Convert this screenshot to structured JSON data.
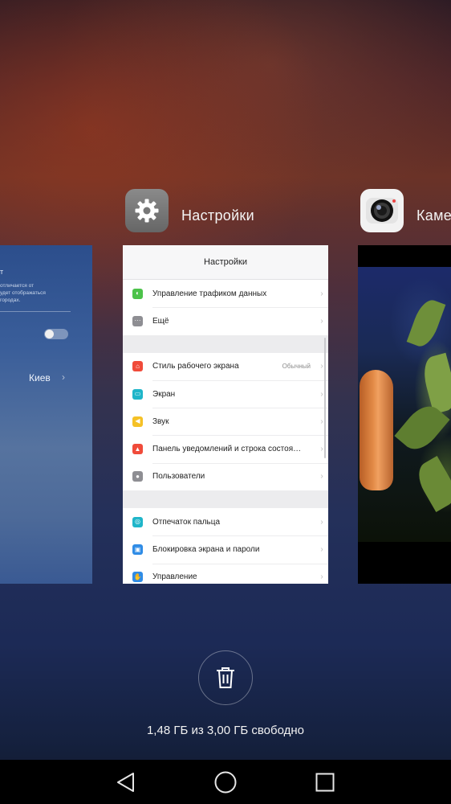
{
  "apps": {
    "left_card": {
      "title_fragment": "т",
      "description_fragment": "отличается от\nудет отображаться\nгородах.",
      "city": "Киев"
    },
    "settings": {
      "title": "Настройки",
      "icon": "gear-icon",
      "card": {
        "header": "Настройки",
        "groups": [
          [
            {
              "label": "Управление трафиком данных",
              "icon": "traffic-icon",
              "color": "#4cc24a",
              "value": ""
            },
            {
              "label": "Ещё",
              "icon": "more-icon",
              "color": "#8e8e93",
              "value": ""
            }
          ],
          [
            {
              "label": "Стиль рабочего экрана",
              "icon": "home-style-icon",
              "color": "#f04b3a",
              "value": "Обычный"
            },
            {
              "label": "Экран",
              "icon": "display-icon",
              "color": "#1fb5c9",
              "value": ""
            },
            {
              "label": "Звук",
              "icon": "sound-icon",
              "color": "#f5c126",
              "value": ""
            },
            {
              "label": "Панель уведомлений и строка состоя…",
              "icon": "notification-icon",
              "color": "#f04b3a",
              "value": ""
            },
            {
              "label": "Пользователи",
              "icon": "users-icon",
              "color": "#8e8e93",
              "value": ""
            }
          ],
          [
            {
              "label": "Отпечаток пальца",
              "icon": "fingerprint-icon",
              "color": "#1fb5c9",
              "value": ""
            },
            {
              "label": "Блокировка экрана и пароли",
              "icon": "lock-icon",
              "color": "#2f8ce6",
              "value": ""
            },
            {
              "label": "Управление",
              "icon": "manage-icon",
              "color": "#2f8ce6",
              "value": ""
            }
          ]
        ]
      }
    },
    "camera": {
      "title": "Камера",
      "icon": "camera-lens-icon"
    }
  },
  "memory": {
    "text": "1,48 ГБ из 3,00 ГБ свободно"
  },
  "navbar": {
    "back": "back-triangle-icon",
    "home": "home-circle-icon",
    "recent": "recent-square-icon"
  }
}
